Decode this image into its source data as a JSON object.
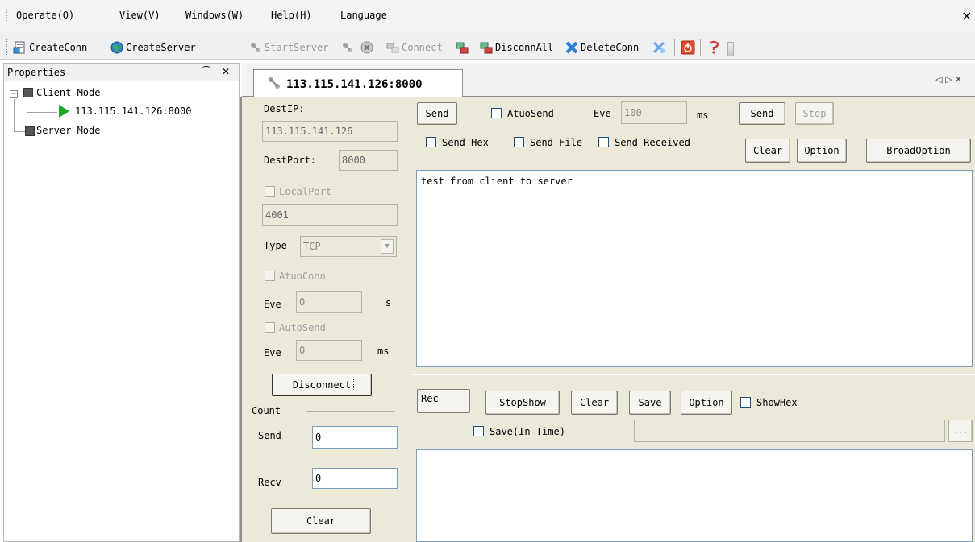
{
  "menu": {
    "items": [
      "Operate(O)",
      "View(V)",
      "Windows(W)",
      "Help(H)",
      "Language"
    ],
    "close_glyph": "×"
  },
  "toolbar": {
    "create_conn": "CreateConn",
    "create_server": "CreateServer",
    "start_server": "StartServer",
    "connect": "Connect",
    "disconn_all": "DisconnAll",
    "delete_conn": "DeleteConn"
  },
  "properties": {
    "title": "Properties",
    "pin_glyph": "⁀",
    "close_glyph": "✕",
    "tree": {
      "client_mode": "Client Mode",
      "connection": "113.115.141.126:8000",
      "server_mode": "Server Mode"
    }
  },
  "tab": {
    "label": "113.115.141.126:8000",
    "nav_glyphs": "◁ ▷ ✕"
  },
  "conn": {
    "dest_ip_label": "DestIP:",
    "dest_ip": "113.115.141.126",
    "dest_port_label": "DestPort:",
    "dest_port": "8000",
    "local_port_label": "LocalPort",
    "local_port": "4001",
    "type_label": "Type",
    "type_value": "TCP",
    "auto_conn_label": "AtuoConn",
    "eve_label": "Eve",
    "auto_conn_eve": "0",
    "sec_unit": "s",
    "auto_send_label": "AutoSend",
    "auto_send_eve": "0",
    "ms_unit": "ms",
    "disconnect_label": "Disconnect"
  },
  "count": {
    "title": "Count",
    "send_label": "Send",
    "send_value": "0",
    "recv_label": "Recv",
    "recv_value": "0",
    "clear_label": "Clear"
  },
  "send": {
    "panel_label": "Send",
    "auto_send_label": "AtuoSend",
    "eve_label": "Eve",
    "eve_value": "100",
    "ms_unit": "ms",
    "send_button": "Send",
    "stop_button": "Stop",
    "send_hex_label": "Send Hex",
    "send_file_label": "Send File",
    "send_received_label": "Send Received",
    "clear_button": "Clear",
    "option_button": "Option",
    "broad_option_button": "BroadOption",
    "text": "test from client to server"
  },
  "recv": {
    "panel_label": "Rec",
    "stop_show_button": "StopShow",
    "clear_button": "Clear",
    "save_button": "Save",
    "option_button": "Option",
    "show_hex_label": "ShowHex",
    "save_in_time_label": "Save(In Time)",
    "browse_glyph": "..."
  }
}
